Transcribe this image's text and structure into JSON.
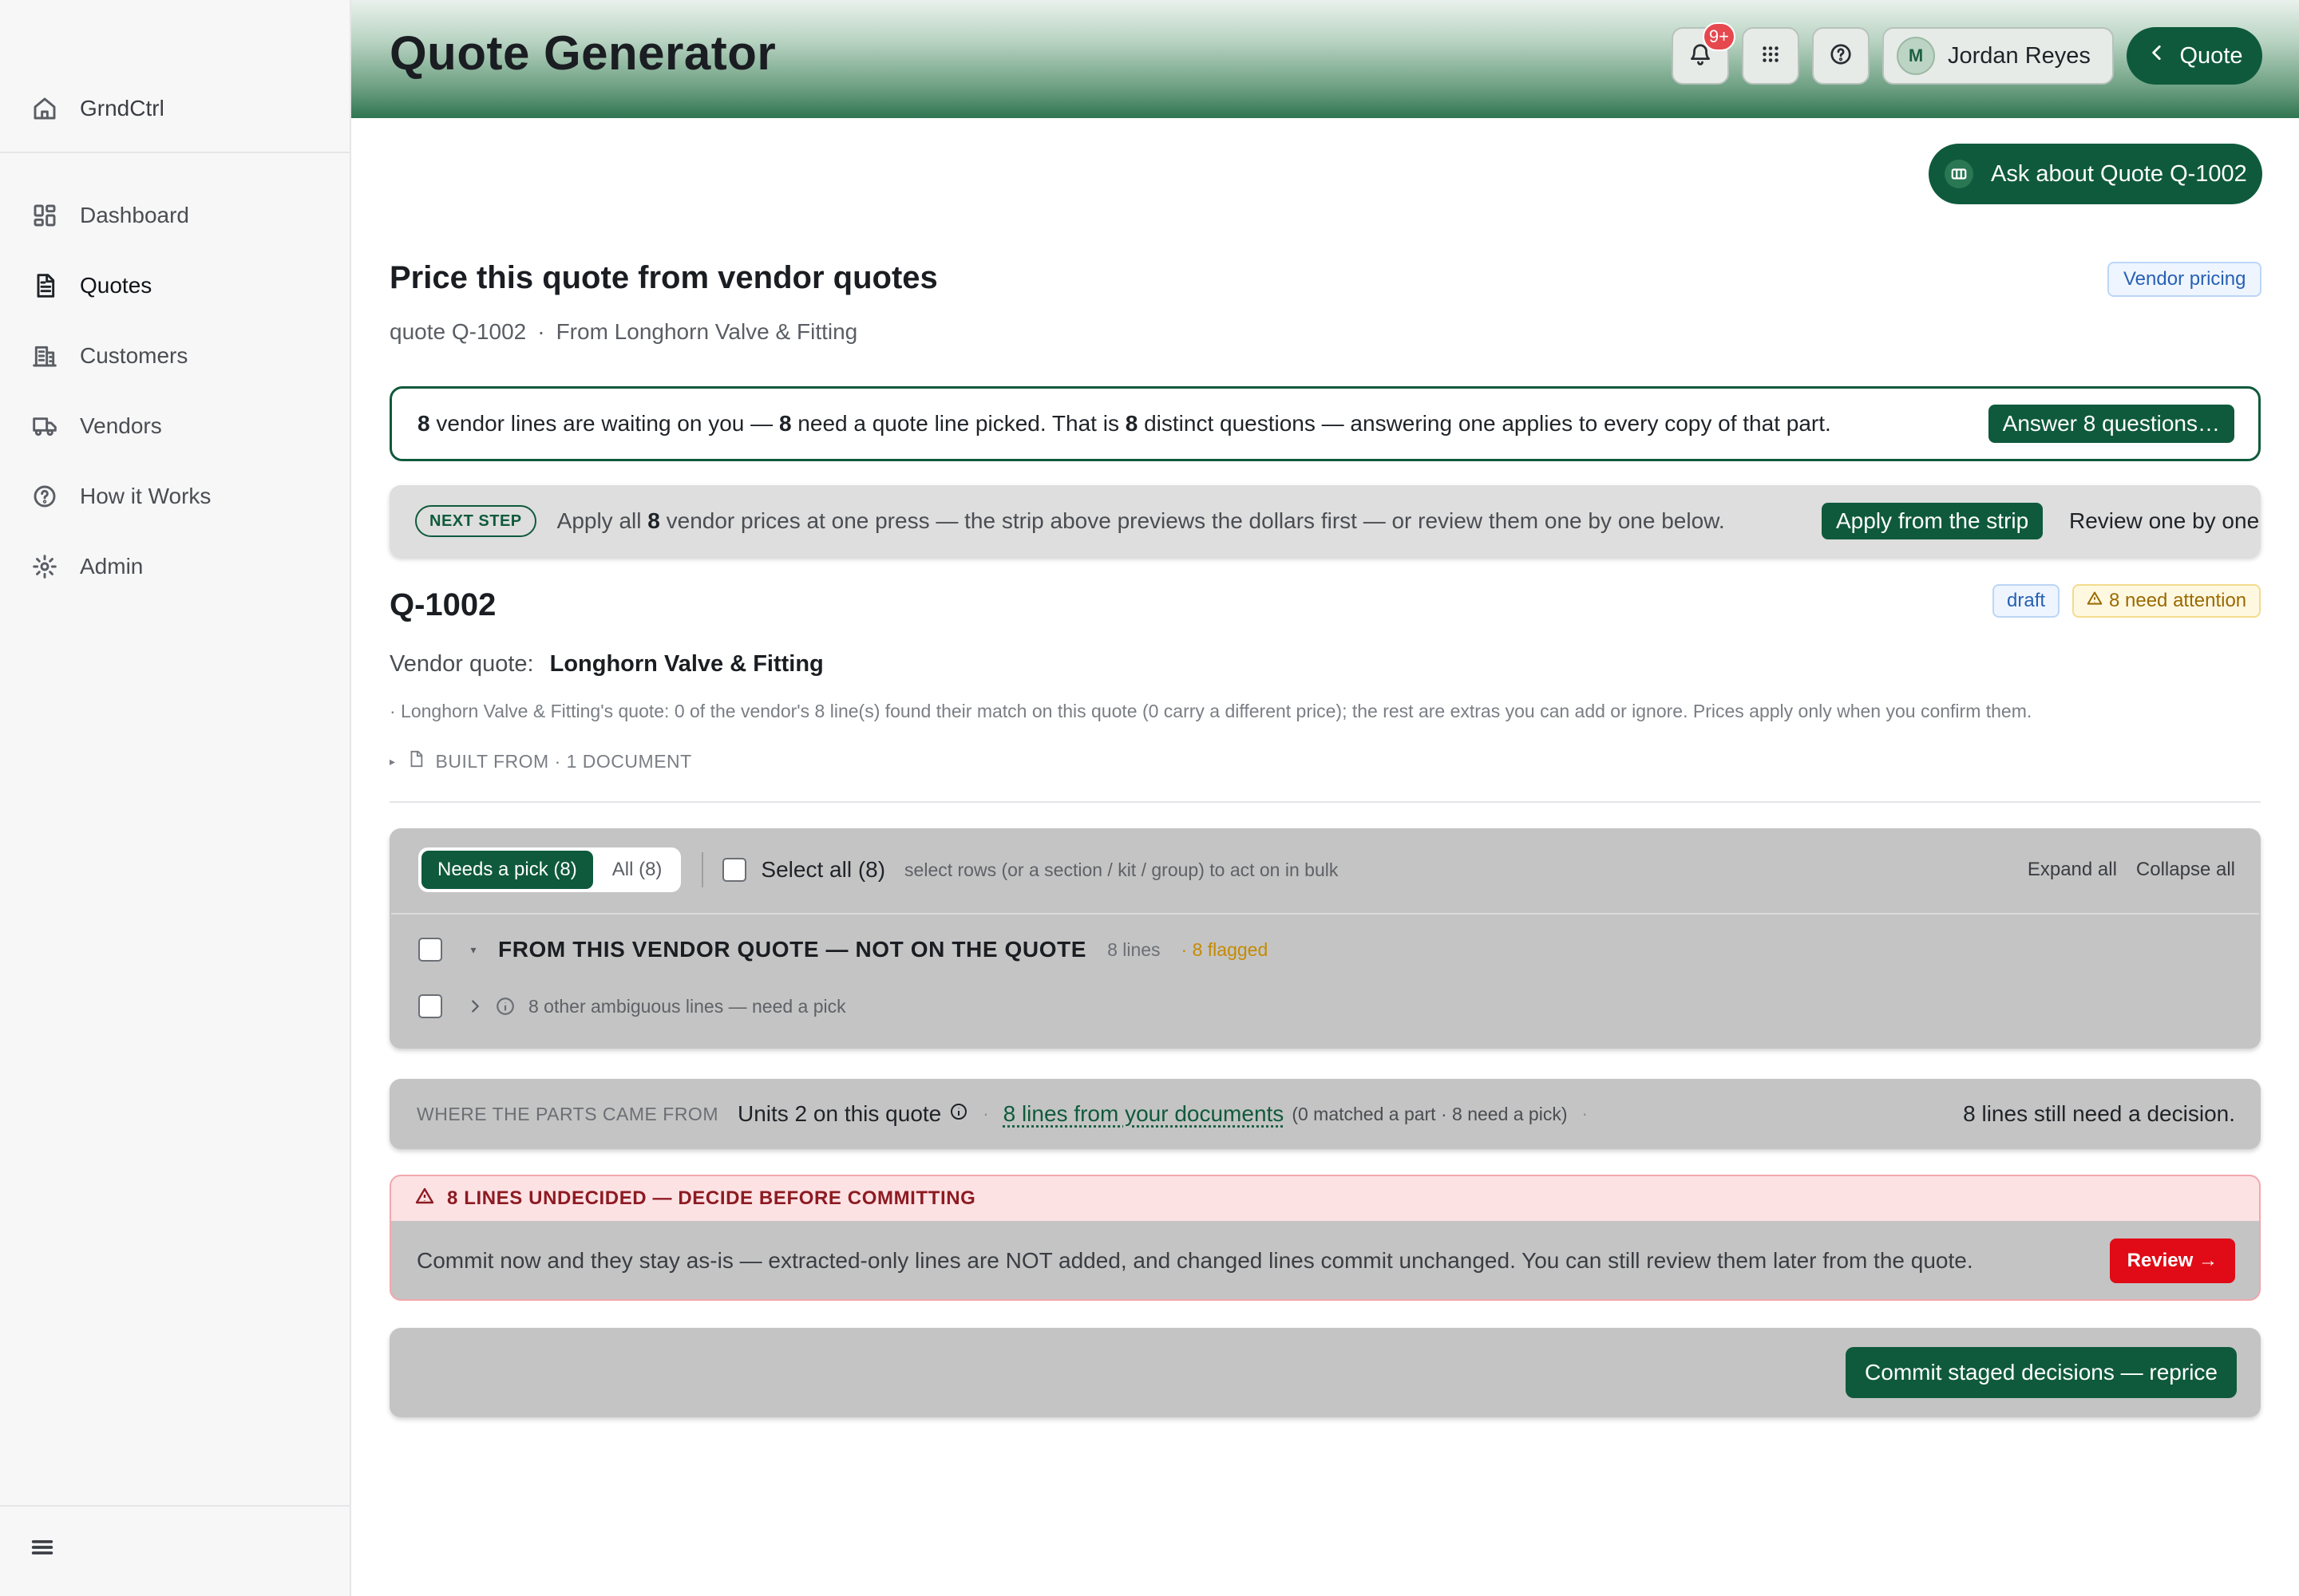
{
  "sidebar": {
    "brand": "GrndCtrl",
    "items": [
      {
        "label": "Dashboard",
        "icon": "dashboard-icon"
      },
      {
        "label": "Quotes",
        "icon": "document-icon"
      },
      {
        "label": "Customers",
        "icon": "building-icon"
      },
      {
        "label": "Vendors",
        "icon": "truck-icon"
      },
      {
        "label": "How it Works",
        "icon": "help-circle-icon"
      },
      {
        "label": "Admin",
        "icon": "gear-icon"
      }
    ],
    "active": "Quotes"
  },
  "header": {
    "title": "Quote Generator",
    "notifications_badge": "9+",
    "user": {
      "initial": "M",
      "name": "Jordan Reyes"
    },
    "back_label": "Quote"
  },
  "ask_button": "Ask about Quote Q-1002",
  "section": {
    "title": "Price this quote from vendor quotes",
    "tag": "Vendor pricing",
    "quote_ref": "quote Q-1002",
    "separator": "·",
    "source": "From Longhorn Valve & Fitting"
  },
  "notice": {
    "n1": "8",
    "t1": " vendor lines are waiting on you — ",
    "n2": "8",
    "t2": " need a quote line picked. That is ",
    "n3": "8",
    "t3": " distinct questions — answering one applies to every copy of that part.",
    "button": "Answer 8 questions…"
  },
  "next_step": {
    "pill": "NEXT STEP",
    "t1": "Apply all ",
    "n1": "8",
    "t2": " vendor prices at one press — the strip above previews the dollars first — or review them one by one below.",
    "apply_button": "Apply from the strip",
    "review_button": "Review one by one"
  },
  "quote": {
    "id": "Q-1002",
    "status": "draft",
    "attention": "8 need attention",
    "vendor_label": "Vendor quote:",
    "vendor_name": "Longhorn Valve & Fitting",
    "note": "· Longhorn Valve & Fitting's quote: 0 of the vendor's 8 line(s) found their match on this quote (0 carry a different price); the rest are extras you can add or ignore. Prices apply only when you confirm them.",
    "built_from": "BUILT FROM · 1 DOCUMENT"
  },
  "list": {
    "filters": [
      {
        "label": "Needs a pick (8)",
        "active": true
      },
      {
        "label": "All (8)",
        "active": false
      }
    ],
    "select_all": "Select all (8)",
    "hint": "select rows (or a section / kit / group) to act on in bulk",
    "expand_all": "Expand all",
    "collapse_all": "Collapse all",
    "group": {
      "title": "FROM THIS VENDOR QUOTE — NOT ON THE QUOTE",
      "count": "8 lines",
      "flagged": "· 8 flagged",
      "sub_row": "8 other ambiguous lines — need a pick"
    }
  },
  "source_strip": {
    "label": "WHERE THE PARTS CAME FROM",
    "units": "Units 2 on this quote",
    "dot": "·",
    "link": "8 lines from your documents",
    "paren": "(0 matched a part · 8 need a pick)",
    "dot2": "·",
    "right": "8 lines still need a decision."
  },
  "warning": {
    "title": "8 LINES UNDECIDED — DECIDE BEFORE COMMITTING",
    "body": "Commit now and they stay as-is — extracted-only lines are NOT added, and changed lines commit unchanged. You can still review them later from the quote.",
    "button": "Review →"
  },
  "commit": {
    "button": "Commit staged decisions — reprice"
  },
  "colors": {
    "brand_green": "#0f5a3c",
    "danger_red": "#e00b16",
    "badge_red": "#e5484d",
    "flag_amber": "#c58a00"
  }
}
